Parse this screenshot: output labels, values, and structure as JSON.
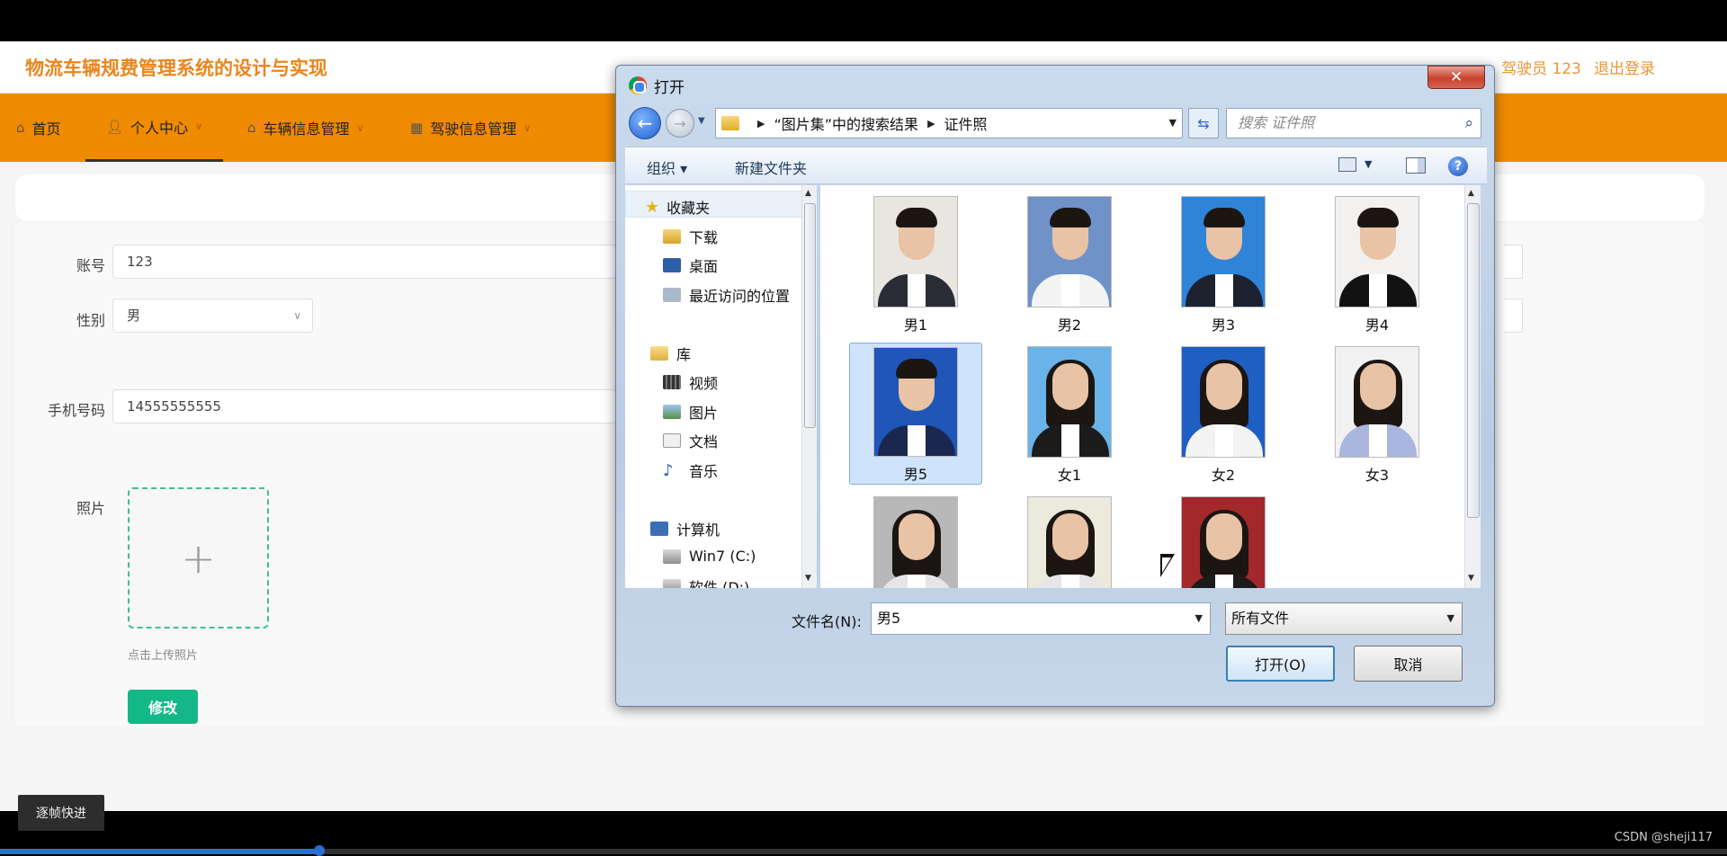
{
  "app": {
    "title": "物流车辆规费管理系统的设计与实现",
    "user_label": "驾驶员 123",
    "logout_label": "退出登录"
  },
  "nav": {
    "items": [
      {
        "label": "首页",
        "icon": "home-icon"
      },
      {
        "label": "个人中心",
        "icon": "user-icon",
        "active": true
      },
      {
        "label": "车辆信息管理",
        "icon": "car-icon"
      },
      {
        "label": "驾驶信息管理",
        "icon": "grid-icon"
      }
    ]
  },
  "form": {
    "account_label": "账号",
    "account_value": "123",
    "gender_label": "性别",
    "gender_value": "男",
    "phone_label": "手机号码",
    "phone_value": "14555555555",
    "photo_label": "照片",
    "upload_tip": "点击上传照片",
    "submit_label": "修改"
  },
  "dialog": {
    "title": "打开",
    "close_label": "✕",
    "address": {
      "part1": "“图片集”中的搜索结果",
      "part2": "证件照"
    },
    "search_placeholder": "搜索 证件照",
    "toolbar": {
      "organize": "组织 ▾",
      "new_folder": "新建文件夹"
    },
    "sidebar": {
      "favorites": "收藏夹",
      "downloads": "下载",
      "desktop": "桌面",
      "recent": "最近访问的位置",
      "libraries": "库",
      "videos": "视频",
      "pictures": "图片",
      "documents": "文档",
      "music": "音乐",
      "computer": "计算机",
      "drive_c": "Win7 (C:)",
      "drive_d": "软件 (D:)"
    },
    "files": [
      {
        "name": "男1",
        "bg": "#e9e6e2",
        "outfit": "#2a2d36"
      },
      {
        "name": "男2",
        "bg": "#6f92c9",
        "outfit": "#f4f4f4"
      },
      {
        "name": "男3",
        "bg": "#2f84d8",
        "outfit": "#1d2230"
      },
      {
        "name": "男4",
        "bg": "#f2f1ef",
        "outfit": "#121212"
      },
      {
        "name": "男5",
        "bg": "#1f56b8",
        "outfit": "#1a2850",
        "selected": true
      },
      {
        "name": "女1",
        "bg": "#6ab3e8",
        "outfit": "#1b1b1b"
      },
      {
        "name": "女2",
        "bg": "#1e5fc4",
        "outfit": "#f3f3f3"
      },
      {
        "name": "女3",
        "bg": "#f1f1f1",
        "outfit": "#a9b6df"
      },
      {
        "name": "",
        "bg": "#b8b8b8",
        "outfit": "#e6e6e6"
      },
      {
        "name": "",
        "bg": "#ece9dd",
        "outfit": "#e6e6e6"
      },
      {
        "name": "",
        "bg": "#a3282c",
        "outfit": "#1b1b1b"
      }
    ],
    "filename_label": "文件名(N):",
    "filename_value": "男5",
    "filetype_value": "所有文件",
    "open_label": "打开(O)",
    "cancel_label": "取消"
  },
  "video": {
    "frame_button": "逐帧快进",
    "progress": 0.185
  },
  "watermark": "CSDN @sheji117"
}
